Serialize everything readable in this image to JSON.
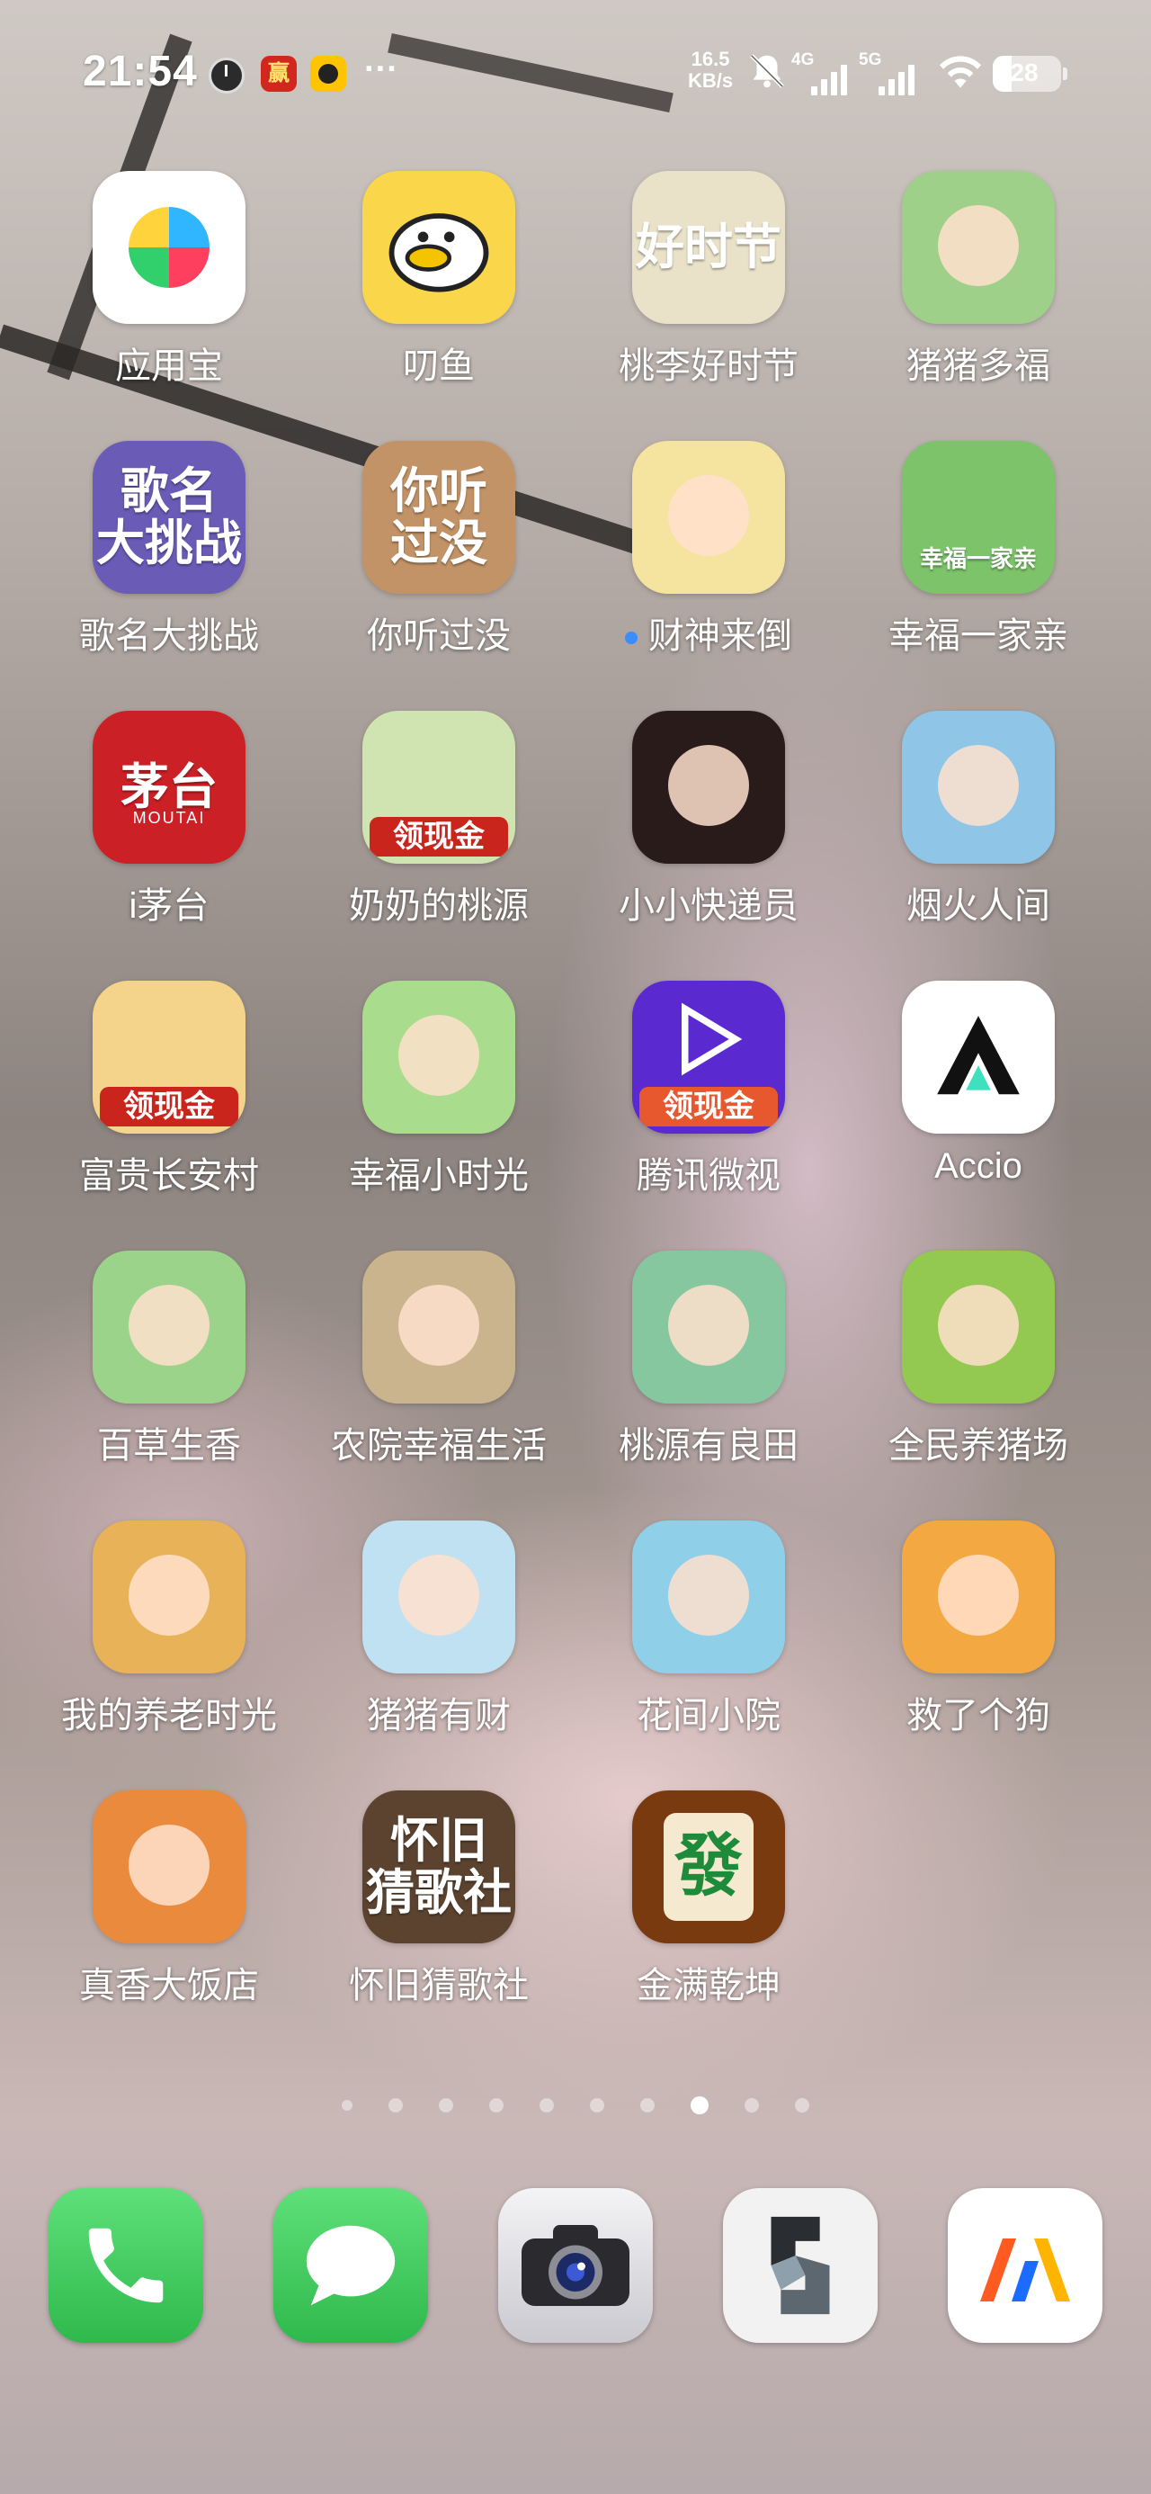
{
  "status_bar": {
    "time": "21:54",
    "red_app_glyph": "赢",
    "more": "···",
    "speed_value": "16.5",
    "speed_unit": "KB/s",
    "net1": "4G",
    "net2": "5G",
    "battery": "28",
    "battery_level": 0.28,
    "icons": [
      "clock-app-icon",
      "red-app-icon",
      "yellow-app-icon",
      "mute-icon",
      "signal-icon",
      "wifi-icon",
      "battery-icon"
    ]
  },
  "apps": [
    {
      "label": "应用宝",
      "glyph": "",
      "bg": "#ffffff",
      "icon": "app-store-icon"
    },
    {
      "label": "叨鱼",
      "glyph": "",
      "bg": "#f9d64a",
      "icon": "fish-icon"
    },
    {
      "label": "桃李好时节",
      "glyph": "好时节",
      "bg": "#e9e2c9",
      "icon": "girl-game-icon"
    },
    {
      "label": "猪猪多福",
      "glyph": "",
      "bg": "#9fd08a",
      "icon": "pig-apple-icon"
    },
    {
      "label": "歌名大挑战",
      "glyph": "歌名\n大挑战",
      "bg": "#6a5bb7",
      "icon": "song-quiz-icon"
    },
    {
      "label": "你听过没",
      "glyph": "你听\n过没",
      "bg": "#c29366",
      "icon": "music-quiz-icon"
    },
    {
      "label": "财神来倒",
      "glyph": "",
      "bg": "#f5e3a0",
      "icon": "fortune-god-icon",
      "new": true
    },
    {
      "label": "幸福一家亲",
      "glyph": "幸福一家亲",
      "bg": "#7cc36a",
      "icon": "family-game-icon"
    },
    {
      "label": "i茅台",
      "glyph": "茅台",
      "bg": "#cc2027",
      "icon": "moutai-icon",
      "sub": "MOUTAI"
    },
    {
      "label": "奶奶的桃源",
      "glyph": "领现金",
      "bg": "#cfe4b0",
      "icon": "lady-game-icon"
    },
    {
      "label": "小小快递员",
      "glyph": "",
      "bg": "#2a1b1b",
      "icon": "portrait-game-icon"
    },
    {
      "label": "烟火人间",
      "glyph": "",
      "bg": "#8fc6e8",
      "icon": "girl-orchard-icon"
    },
    {
      "label": "富贵长安村",
      "glyph": "领现金",
      "bg": "#f4d48a",
      "icon": "tang-girl-icon"
    },
    {
      "label": "幸福小时光",
      "glyph": "",
      "bg": "#a9dc8c",
      "icon": "pig-monkey-icon"
    },
    {
      "label": "腾讯微视",
      "glyph": "领现金",
      "bg": "#5a2ad0",
      "icon": "weishi-icon"
    },
    {
      "label": "Accio",
      "glyph": "",
      "bg": "#ffffff",
      "icon": "accio-icon"
    },
    {
      "label": "百草生香",
      "glyph": "",
      "bg": "#9bd38a",
      "icon": "herb-girl-icon"
    },
    {
      "label": "农院幸福生活",
      "glyph": "",
      "bg": "#c9b48e",
      "icon": "farmer-icon"
    },
    {
      "label": "桃源有良田",
      "glyph": "",
      "bg": "#86c7a0",
      "icon": "village-girl-icon"
    },
    {
      "label": "全民养猪场",
      "glyph": "",
      "bg": "#93c951",
      "icon": "pig-farm-icon"
    },
    {
      "label": "我的养老时光",
      "glyph": "",
      "bg": "#e7b258",
      "icon": "business-woman-icon"
    },
    {
      "label": "猪猪有财",
      "glyph": "",
      "bg": "#bfe1f2",
      "icon": "pig-farmer-icon"
    },
    {
      "label": "花间小院",
      "glyph": "",
      "bg": "#8fd0e8",
      "icon": "garden-girl-icon"
    },
    {
      "label": "救了个狗",
      "glyph": "",
      "bg": "#f4a841",
      "icon": "dog-icon"
    },
    {
      "label": "真香大饭店",
      "glyph": "",
      "bg": "#e98a3c",
      "icon": "restaurant-icon"
    },
    {
      "label": "怀旧猜歌社",
      "glyph": "怀旧\n猜歌社",
      "bg": "#5b4330",
      "icon": "retro-radio-icon"
    },
    {
      "label": "金满乾坤",
      "glyph": "發",
      "bg": "#7a3a10",
      "icon": "mahjong-icon"
    }
  ],
  "pager": {
    "count": 10,
    "active": 7
  },
  "dock": [
    {
      "name": "phone",
      "icon": "phone-icon",
      "bg": "#35c759"
    },
    {
      "name": "messages",
      "icon": "message-icon",
      "bg": "#35c759"
    },
    {
      "name": "camera",
      "icon": "camera-icon",
      "bg": "#d9d9de"
    },
    {
      "name": "s-app",
      "icon": "s-app-icon",
      "bg": "#f2f2f2"
    },
    {
      "name": "m-app",
      "icon": "m-app-icon",
      "bg": "#ffffff"
    }
  ]
}
